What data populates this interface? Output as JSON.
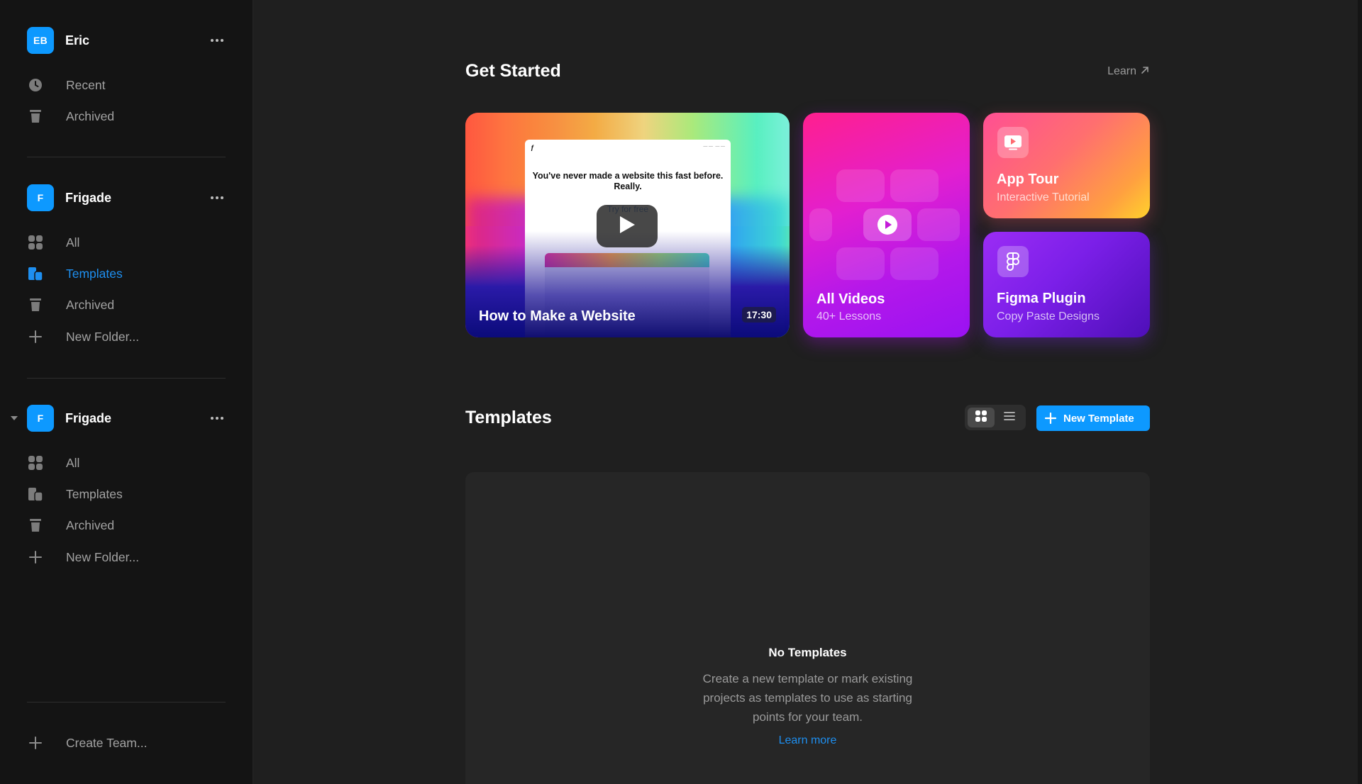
{
  "sidebar": {
    "user": {
      "initials": "EB",
      "name": "Eric"
    },
    "user_items": [
      {
        "label": "Recent",
        "icon": "clock-icon"
      },
      {
        "label": "Archived",
        "icon": "trash-icon"
      }
    ],
    "team1": {
      "initials": "F",
      "name": "Frigade",
      "items": [
        {
          "label": "All",
          "icon": "grid-icon"
        },
        {
          "label": "Templates",
          "icon": "templates-icon",
          "active": true
        },
        {
          "label": "Archived",
          "icon": "trash-icon"
        },
        {
          "label": "New Folder...",
          "icon": "plus-icon"
        }
      ]
    },
    "team2": {
      "initials": "F",
      "name": "Frigade",
      "items": [
        {
          "label": "All",
          "icon": "grid-icon"
        },
        {
          "label": "Templates",
          "icon": "templates-icon"
        },
        {
          "label": "Archived",
          "icon": "trash-icon"
        },
        {
          "label": "New Folder...",
          "icon": "plus-icon"
        }
      ]
    },
    "create_team": "Create Team..."
  },
  "get_started": {
    "title": "Get Started",
    "learn": "Learn",
    "video_card": {
      "title": "How to Make a Website",
      "duration": "17:30",
      "preview_headline": "You've never made a website this fast before. Really.",
      "preview_cta": "Try for free"
    },
    "all_videos": {
      "title": "All Videos",
      "subtitle": "40+ Lessons"
    },
    "app_tour": {
      "title": "App Tour",
      "subtitle": "Interactive Tutorial"
    },
    "figma_plugin": {
      "title": "Figma Plugin",
      "subtitle": "Copy Paste Designs"
    }
  },
  "templates": {
    "title": "Templates",
    "new_button": "New Template",
    "view_mode": "grid",
    "empty": {
      "title": "No Templates",
      "body": "Create a new template or mark existing projects as templates to use as starting points for your team.",
      "link": "Learn more"
    }
  },
  "colors": {
    "accent": "#0d99ff",
    "active_text": "#1e8ff0",
    "sidebar_bg": "#141414",
    "main_bg": "#1f1f1f"
  }
}
